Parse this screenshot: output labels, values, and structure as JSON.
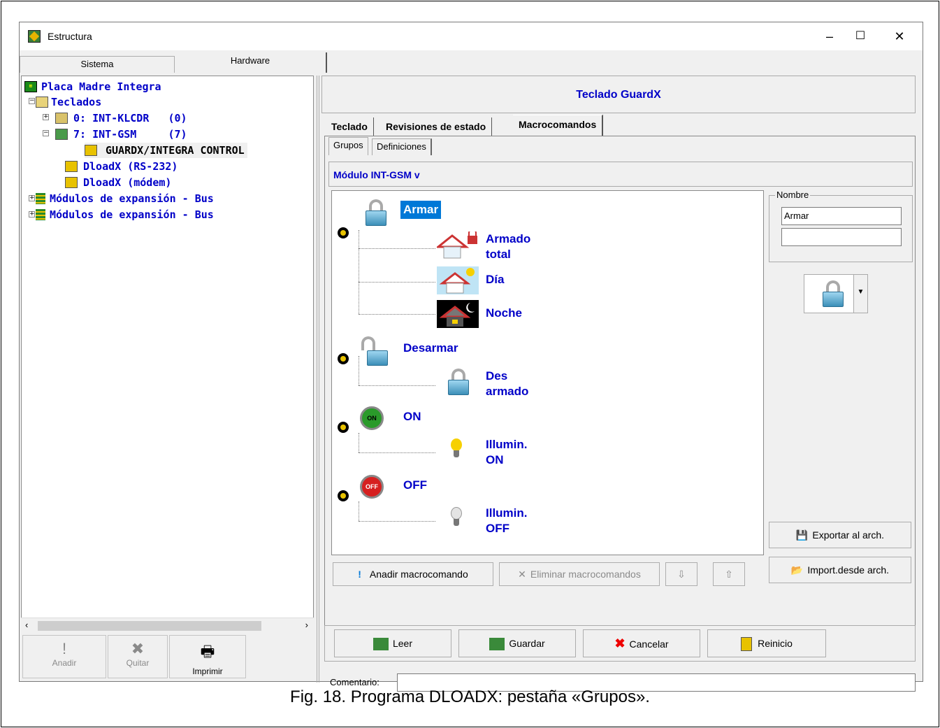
{
  "window": {
    "title": "Estructura",
    "minimize": "–",
    "maximize": "☐",
    "close": "✕"
  },
  "tabs": {
    "sistema": "Sistema",
    "hardware": "Hardware"
  },
  "tree": {
    "root": "Placa Madre Integra",
    "teclados": "Teclados",
    "kp0": "0: INT-KLCDR   (0)",
    "kp7": "7: INT-GSM     (7)",
    "guardx": "GUARDX/INTEGRA CONTROL",
    "dload232": "DloadX (RS-232)",
    "dloadmodem": "DloadX (módem)",
    "bus1": "Módulos de expansión - Bus",
    "bus2": "Módulos de expansión - Bus"
  },
  "left_buttons": {
    "add": "Anadir",
    "remove": "Quitar",
    "print": "Imprimir"
  },
  "header": {
    "title": "Teclado GuardX"
  },
  "main_tabs": [
    "Teclado",
    "Revisiones de estado",
    "Macrocomandos"
  ],
  "sub_tabs": [
    "Grupos",
    "Definiciones"
  ],
  "module_label": "Módulo INT-GSM v",
  "groups": [
    {
      "label": "Armar",
      "items": [
        {
          "label1": "Armado",
          "label2": "total"
        },
        {
          "label1": "Día",
          "label2": ""
        },
        {
          "label1": "Noche",
          "label2": ""
        }
      ]
    },
    {
      "label": "Desarmar",
      "items": [
        {
          "label1": "Des",
          "label2": "armado"
        }
      ]
    },
    {
      "label": "ON",
      "items": [
        {
          "label1": "Illumin.",
          "label2": "ON"
        }
      ]
    },
    {
      "label": "OFF",
      "items": [
        {
          "label1": "Illumin.",
          "label2": "OFF"
        }
      ]
    }
  ],
  "list_buttons": {
    "add": "Anadir macrocomando",
    "delete": "Eliminar macrocomandos",
    "down": "⇩",
    "up": "⇧"
  },
  "name_panel": {
    "label": "Nombre",
    "value1": "Armar",
    "value2": ""
  },
  "side_buttons": {
    "export": "Exportar al arch.",
    "import": "Import.desde arch."
  },
  "actions": {
    "read": "Leer",
    "save": "Guardar",
    "cancel": "Cancelar",
    "reset": "Reinicio"
  },
  "comment": {
    "label": "Comentario:",
    "value": ""
  },
  "caption": "Fig. 18. Programa DLOADX: pestaña «Grupos».",
  "colors": {
    "accent": "#0000c8",
    "selection": "#0078d7"
  }
}
